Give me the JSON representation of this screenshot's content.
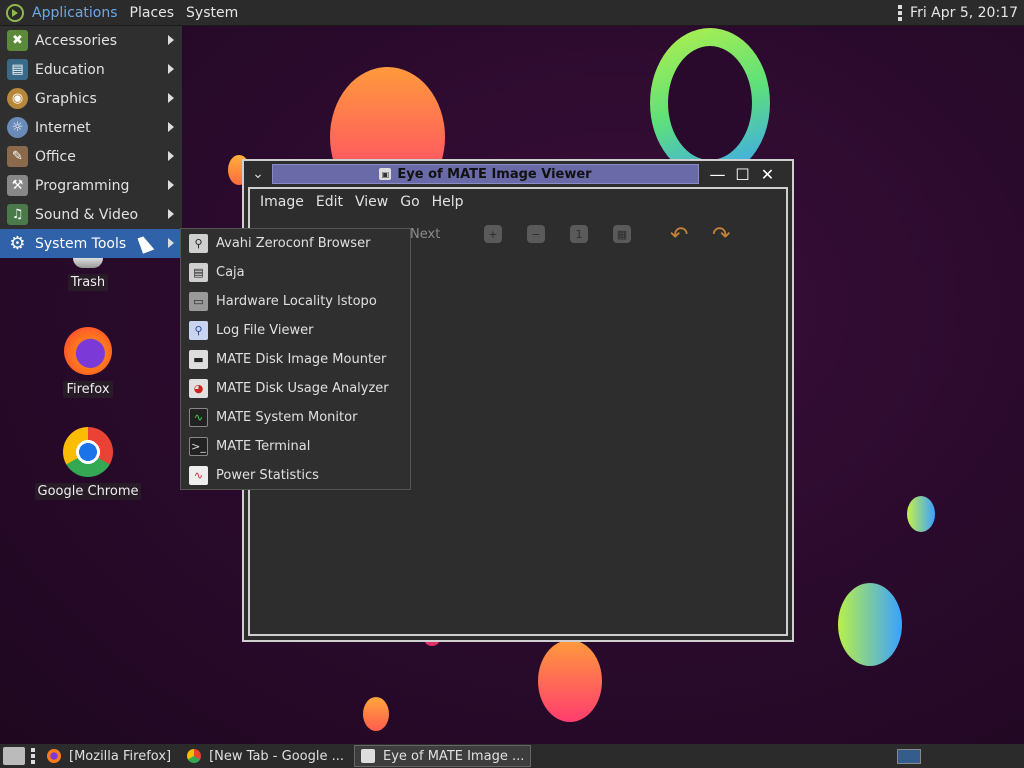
{
  "top_panel": {
    "applications": "Applications",
    "places": "Places",
    "system": "System",
    "clock": "Fri Apr  5, 20:17"
  },
  "app_menu": {
    "items": [
      {
        "label": "Accessories",
        "icon": "accessories-icon"
      },
      {
        "label": "Education",
        "icon": "education-icon"
      },
      {
        "label": "Graphics",
        "icon": "graphics-icon"
      },
      {
        "label": "Internet",
        "icon": "internet-icon"
      },
      {
        "label": "Office",
        "icon": "office-icon"
      },
      {
        "label": "Programming",
        "icon": "programming-icon"
      },
      {
        "label": "Sound & Video",
        "icon": "sound-video-icon"
      },
      {
        "label": "System Tools",
        "icon": "gear-icon",
        "selected": true
      }
    ]
  },
  "system_tools_menu": {
    "items": [
      {
        "label": "Avahi Zeroconf Browser",
        "icon": "zeroconf-icon"
      },
      {
        "label": "Caja",
        "icon": "file-manager-icon"
      },
      {
        "label": "Hardware Locality lstopo",
        "icon": "hardware-icon"
      },
      {
        "label": "Log File Viewer",
        "icon": "log-viewer-icon"
      },
      {
        "label": "MATE Disk Image Mounter",
        "icon": "disk-mounter-icon"
      },
      {
        "label": "MATE Disk Usage Analyzer",
        "icon": "disk-usage-icon"
      },
      {
        "label": "MATE System Monitor",
        "icon": "system-monitor-icon"
      },
      {
        "label": "MATE Terminal",
        "icon": "terminal-icon"
      },
      {
        "label": "Power Statistics",
        "icon": "power-stats-icon"
      }
    ]
  },
  "desktop": {
    "trash": "Trash",
    "firefox": "Firefox",
    "chrome": "Google Chrome"
  },
  "viewer_window": {
    "title": "Eye of MATE Image Viewer",
    "menu": [
      "Image",
      "Edit",
      "View",
      "Go",
      "Help"
    ],
    "toolbar_next": "Next"
  },
  "taskbar": {
    "tasks": [
      {
        "label": "[Mozilla Firefox]",
        "icon": "firefox-icon"
      },
      {
        "label": "[New Tab - Google ...",
        "icon": "chrome-icon"
      },
      {
        "label": "Eye of MATE Image ...",
        "icon": "image-viewer-icon",
        "active": true
      }
    ]
  }
}
